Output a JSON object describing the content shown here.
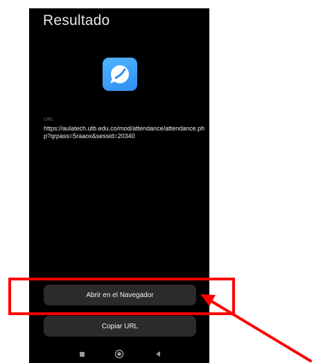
{
  "screen": {
    "title": "Resultado",
    "app_icon": "chat-bubble-icon",
    "url_label": "URL",
    "url_value": "https://aulatech.utb.edu.co/mod/attendance/attendance.php?qrpass=5raaox&sessid=20340"
  },
  "actions": {
    "open_browser_label": "Abrir en el Navegador",
    "copy_url_label": "Copiar URL"
  },
  "navbar": {
    "recents_icon": "recents-square-icon",
    "home_icon": "home-circle-icon",
    "back_icon": "back-triangle-icon"
  },
  "annotation": {
    "color": "#ff0000",
    "highlight": "highlight-box",
    "arrow": "pointer-arrow"
  },
  "colors": {
    "screen_background": "#000000",
    "button_background": "#2b2b2b",
    "icon_blue": "#3a9bf5"
  }
}
